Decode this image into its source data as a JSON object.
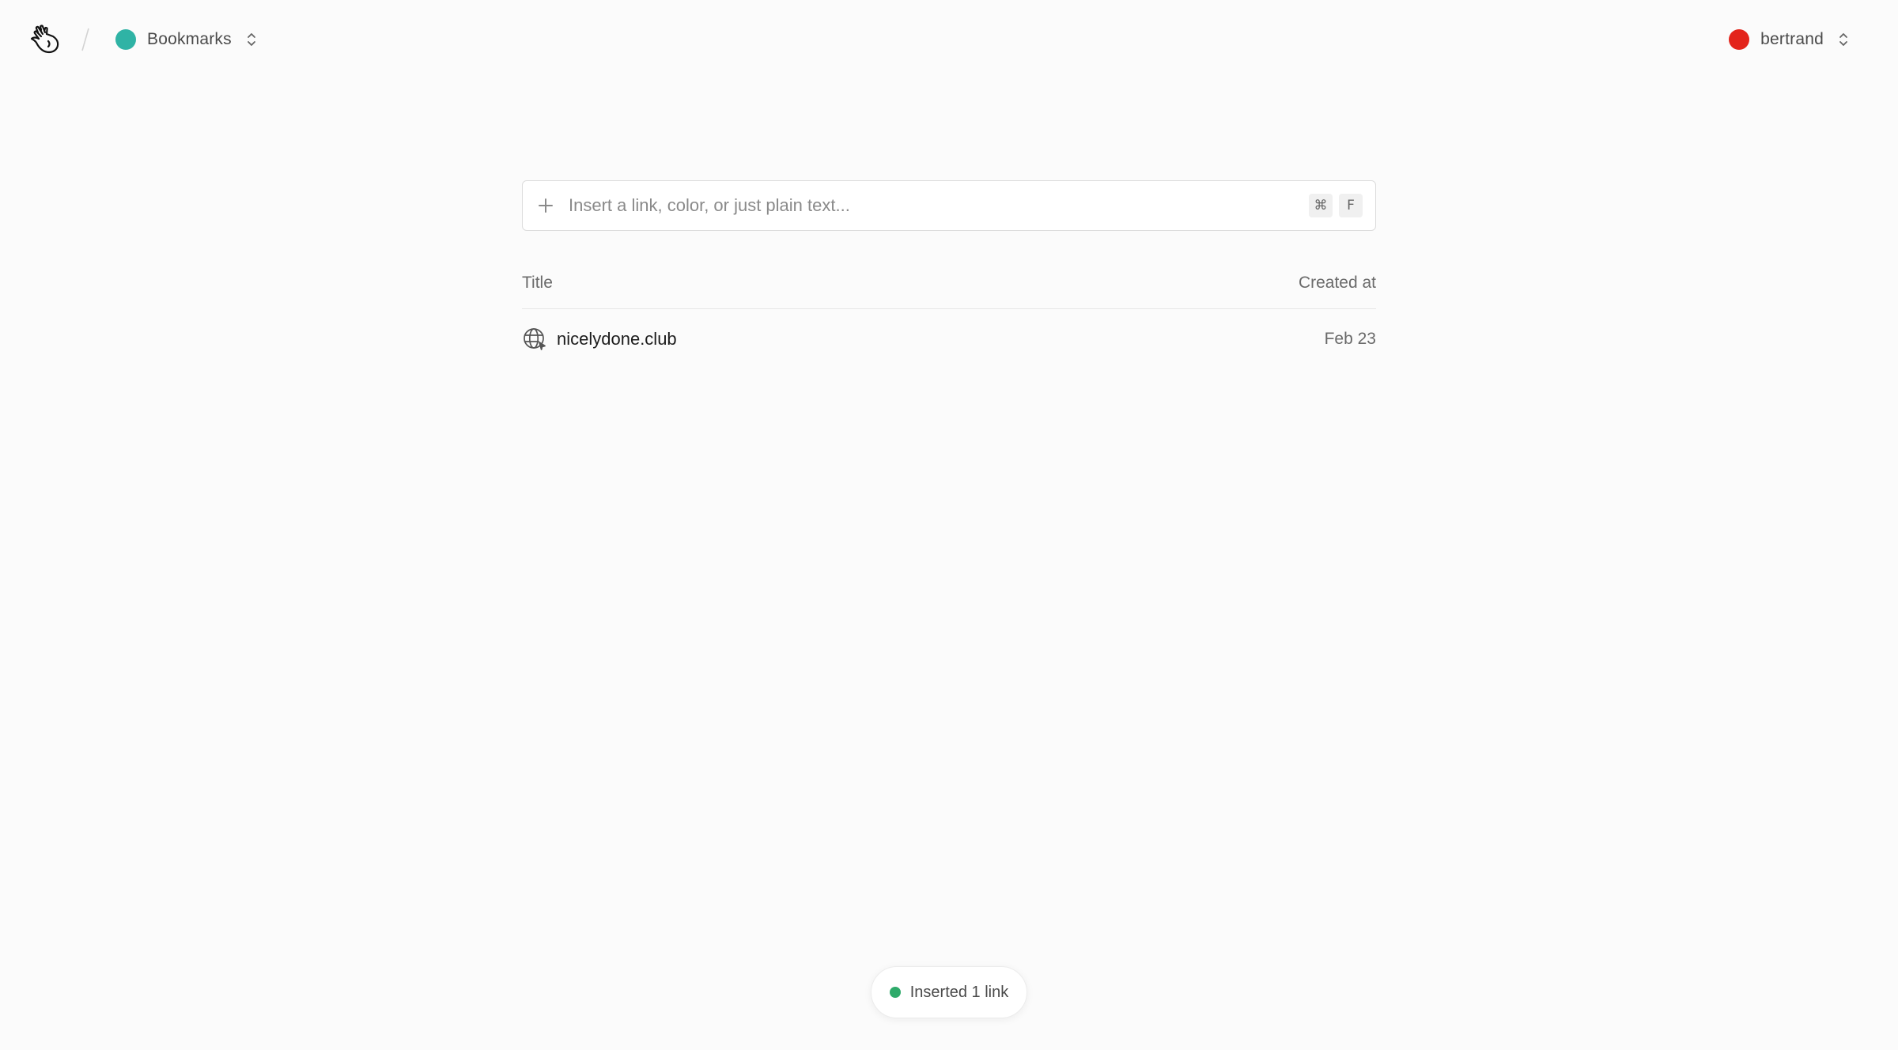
{
  "header": {
    "logo_icon": "hand-wave-icon",
    "divider_icon": "slash-divider-icon",
    "collection": {
      "label": "Bookmarks",
      "color": "#2fb3a5",
      "switch_icon": "chevron-up-down-icon"
    },
    "user": {
      "name": "bertrand",
      "avatar_color": "#e3241b",
      "switch_icon": "chevron-up-down-icon"
    }
  },
  "search": {
    "icon": "plus-icon",
    "placeholder": "Insert a link, color, or just plain text...",
    "value": "",
    "shortcut": [
      "⌘",
      "F"
    ]
  },
  "table": {
    "columns": {
      "title": "Title",
      "created_at": "Created at"
    },
    "rows": [
      {
        "icon": "globe-icon",
        "title": "nicelydone.club",
        "created_at": "Feb 23"
      }
    ]
  },
  "toast": {
    "text": "Inserted 1 link",
    "status_color": "#2eaa6a"
  },
  "colors": {
    "background": "#fbfbfb",
    "text_primary": "#1c1c1c",
    "text_secondary": "#6a6a6a",
    "border": "#dcdcdc"
  }
}
